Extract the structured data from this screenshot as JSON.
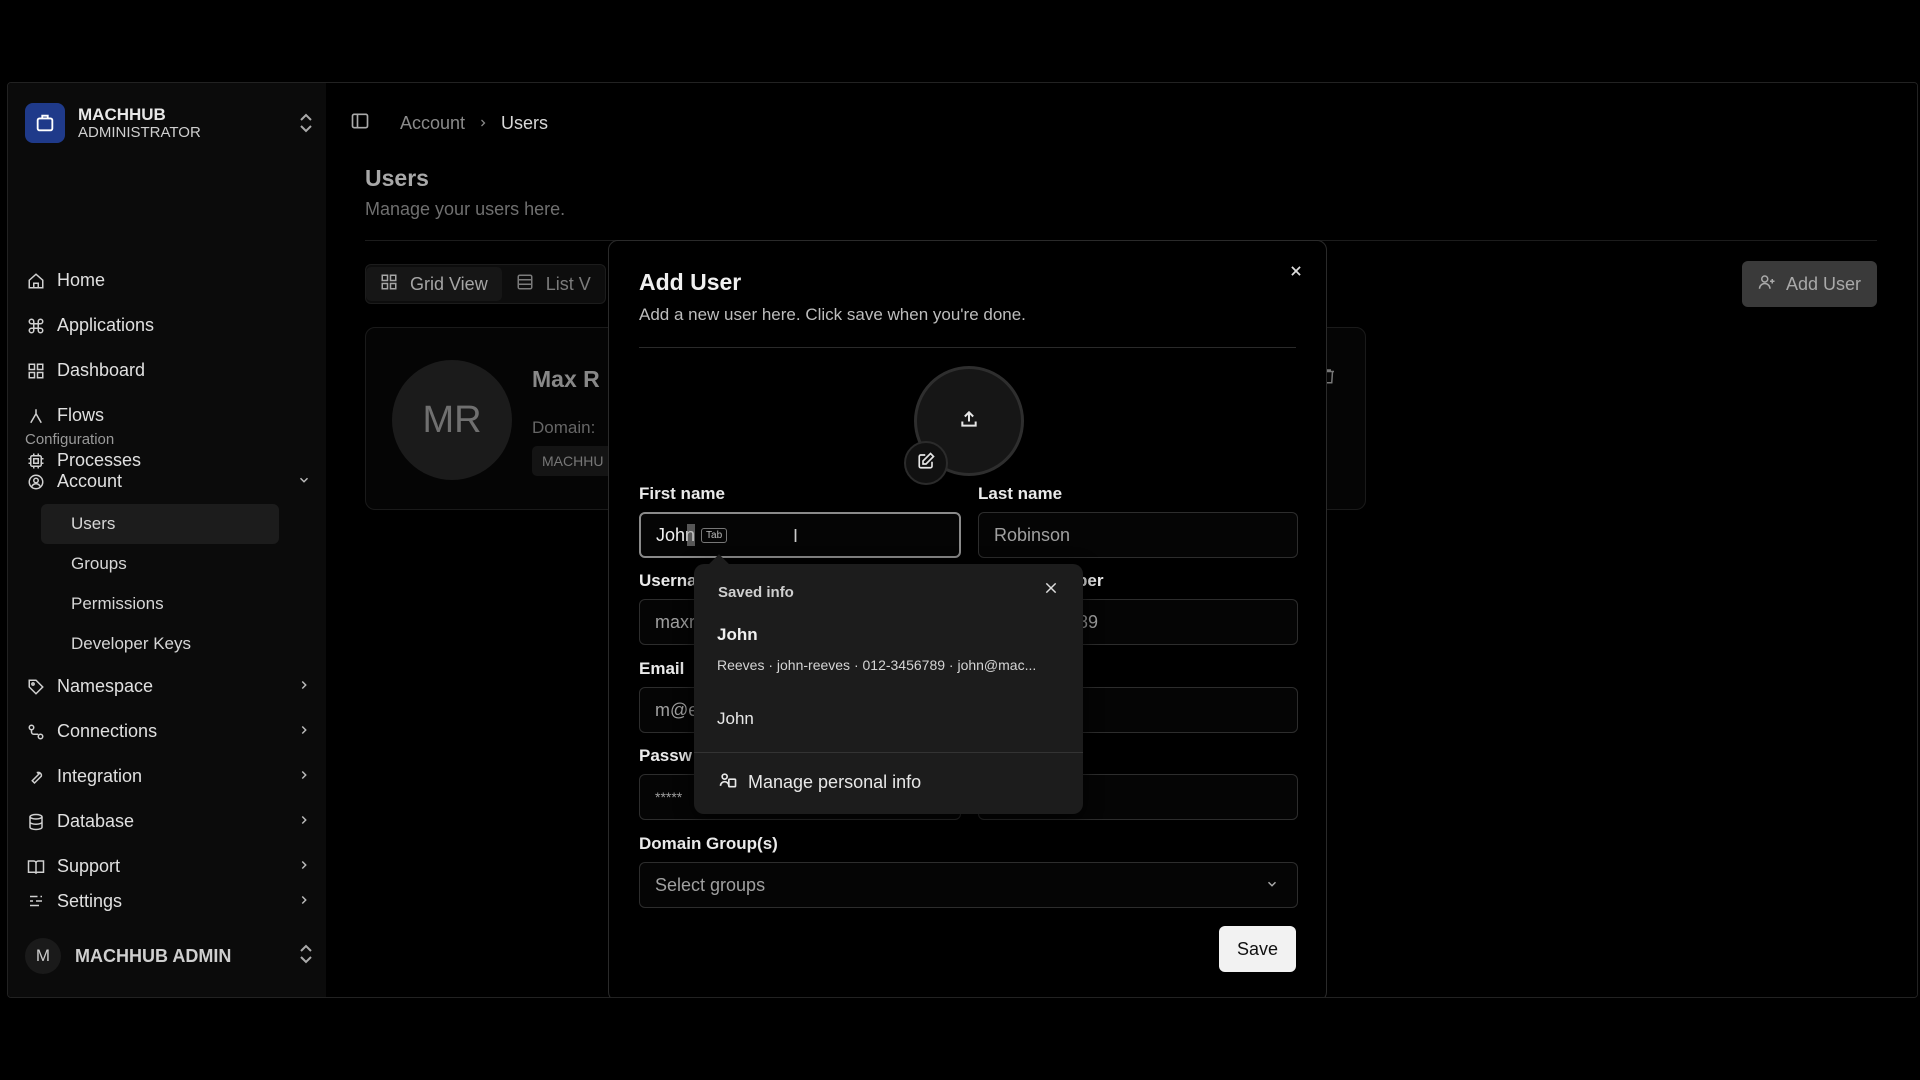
{
  "brand": {
    "name": "MACHHUB",
    "role": "ADMINISTRATOR"
  },
  "nav": {
    "home": "Home",
    "applications": "Applications",
    "dashboard": "Dashboard",
    "flows": "Flows",
    "processes": "Processes"
  },
  "config": {
    "section_label": "Configuration",
    "account": "Account",
    "sub": {
      "users": "Users",
      "groups": "Groups",
      "permissions": "Permissions",
      "developer_keys": "Developer Keys"
    },
    "namespace": "Namespace",
    "connections": "Connections",
    "integration": "Integration",
    "database": "Database",
    "support": "Support",
    "settings": "Settings"
  },
  "footer_user": {
    "initial": "M",
    "name": "MACHHUB ADMIN"
  },
  "breadcrumb": {
    "parent": "Account",
    "current": "Users"
  },
  "page": {
    "title": "Users",
    "subtitle": "Manage your users here."
  },
  "view_toggle": {
    "grid": "Grid View",
    "list": "List V"
  },
  "add_user_label": "Add User",
  "card": {
    "initials": "MR",
    "name": "Max R",
    "domain_label": "Domain:",
    "badge": "MACHHU"
  },
  "modal": {
    "title": "Add User",
    "description": "Add a new user here. Click save when you're done.",
    "first_name_label": "First name",
    "first_name_value": "John",
    "tab_hint": "Tab",
    "last_name_label": "Last name",
    "last_name_placeholder": "Robinson",
    "username_label": "Userna",
    "username_placeholder": "maxr",
    "phone_label": "ber",
    "phone_placeholder": "89",
    "email_label": "Email",
    "email_placeholder": "m@e",
    "password_label": "Passw",
    "password_placeholder": "*****",
    "domain_groups_label": "Domain Group(s)",
    "domain_groups_placeholder": "Select groups",
    "save_label": "Save"
  },
  "autofill": {
    "title": "Saved info",
    "entry_name": "John",
    "entry_details": "Reeves · john-reeves · 012-3456789 · john@mac...",
    "alt_entry": "John",
    "manage_label": "Manage personal info"
  }
}
